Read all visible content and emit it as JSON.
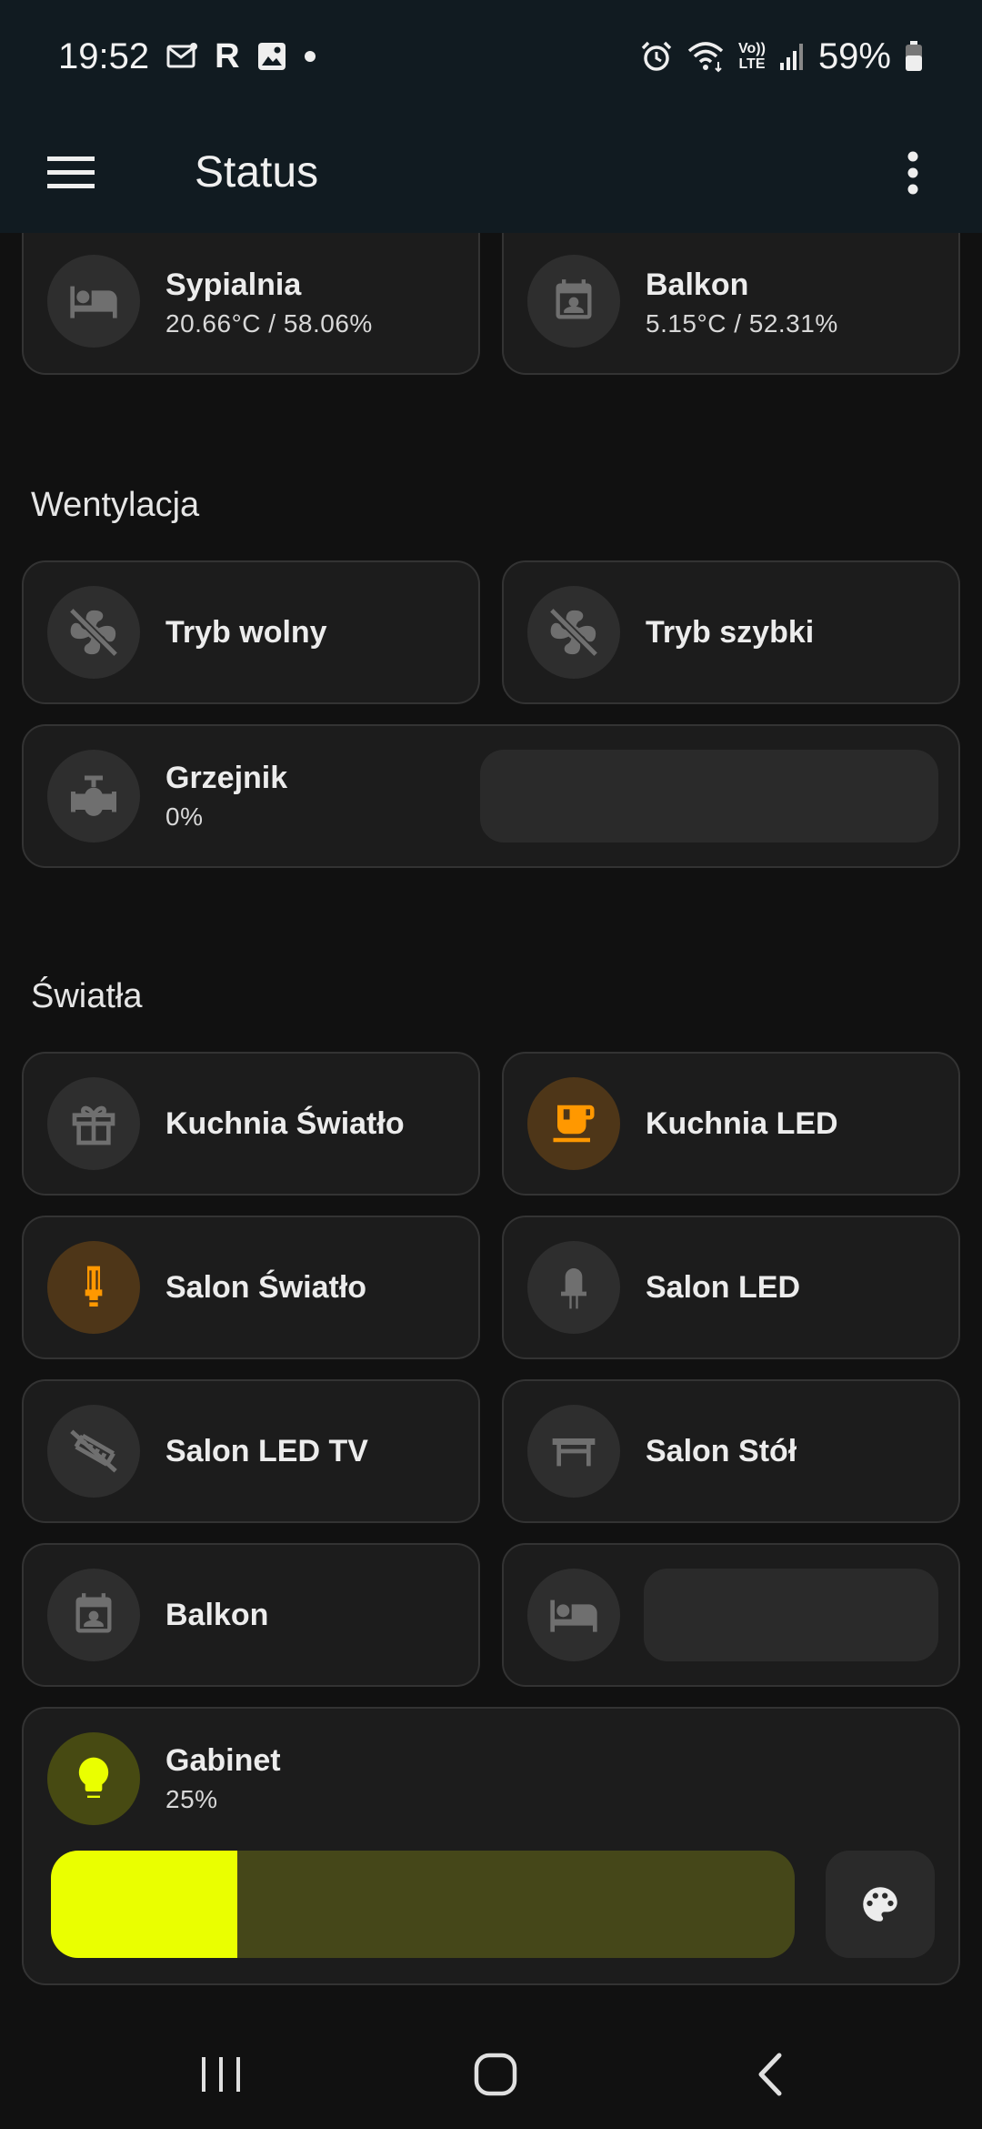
{
  "status_bar": {
    "time": "19:52",
    "battery": "59%",
    "icons_left": [
      "mail-icon",
      "r-app-icon",
      "gallery-icon",
      "dot-icon"
    ],
    "icons_right": [
      "alarm-icon",
      "wifi-icon",
      "volte-icon",
      "signal-icon",
      "battery-icon"
    ],
    "volte_label_top": "Vo))",
    "volte_label_bottom": "LTE"
  },
  "app_bar": {
    "title": "Status"
  },
  "top_cards": [
    {
      "name": "Sypialnia",
      "state": "20.66°C / 58.06%",
      "icon": "bed-icon"
    },
    {
      "name": "Balkon",
      "state": "5.15°C / 52.31%",
      "icon": "calendar-account-icon"
    }
  ],
  "sections": {
    "ventilation": {
      "title": "Wentylacja",
      "cards": [
        {
          "name": "Tryb wolny",
          "icon": "fan-off-icon"
        },
        {
          "name": "Tryb szybki",
          "icon": "fan-off-icon"
        }
      ],
      "radiator": {
        "name": "Grzejnik",
        "state": "0%",
        "icon": "valve-icon"
      }
    },
    "lights": {
      "title": "Światła",
      "cards": [
        {
          "name": "Kuchnia Światło",
          "icon": "gift-off-icon",
          "on": false
        },
        {
          "name": "Kuchnia LED",
          "icon": "cup-icon",
          "on": true
        },
        {
          "name": "Salon Światło",
          "icon": "fluorescent-bulb-icon",
          "on": true
        },
        {
          "name": "Salon LED",
          "icon": "led-icon",
          "on": false
        },
        {
          "name": "Salon LED TV",
          "icon": "led-strip-off-icon",
          "on": false
        },
        {
          "name": "Salon Stół",
          "icon": "table-icon",
          "on": false
        },
        {
          "name": "Balkon",
          "icon": "calendar-account-icon",
          "on": false
        },
        {
          "name": "",
          "icon": "bed-icon",
          "on": false
        }
      ],
      "gabinet": {
        "name": "Gabinet",
        "state": "25%",
        "brightness": 0.25,
        "icon": "lightbulb-icon",
        "color_button_icon": "palette-icon"
      }
    }
  },
  "colors": {
    "accent_orange": "#ff9800",
    "accent_yellow": "#eaff00",
    "slider_track": "#454719",
    "card_bg": "#1c1c1c"
  },
  "nav_bar": {
    "icons": [
      "recent-apps-icon",
      "home-icon",
      "back-icon"
    ]
  }
}
